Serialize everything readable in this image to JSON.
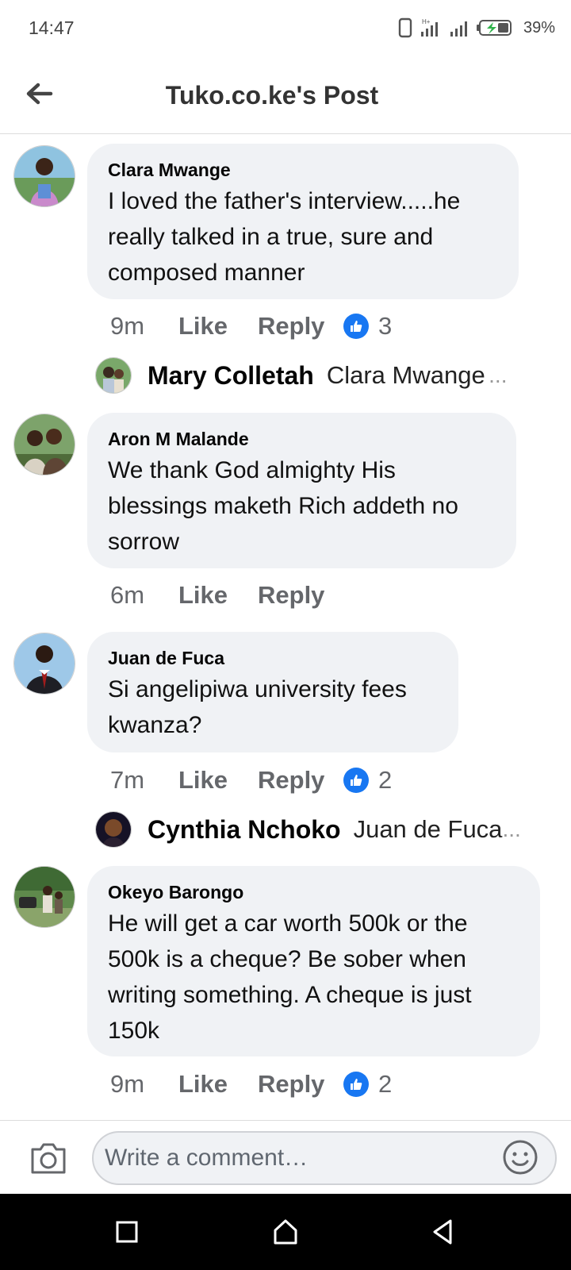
{
  "status_bar": {
    "time": "14:47",
    "battery_percent": "39%"
  },
  "header": {
    "title": "Tuko.co.ke's Post",
    "back_icon": "arrow-left-icon"
  },
  "comments": [
    {
      "author": "Clara Mwange",
      "text": "I loved the father's interview.....he really talked in a true, sure and composed manner",
      "time": "9m",
      "like_label": "Like",
      "reply_label": "Reply",
      "reaction_count": "3",
      "reply": {
        "name": "Mary Colletah",
        "snippet": "Clara Mwange",
        "ellipsis": "..."
      }
    },
    {
      "author": "Aron M Malande",
      "text": "We thank God almighty His blessings maketh Rich addeth no sorrow",
      "time": "6m",
      "like_label": "Like",
      "reply_label": "Reply"
    },
    {
      "author": "Juan de Fuca",
      "text": "Si angelipiwa university fees kwanza?",
      "time": "7m",
      "like_label": "Like",
      "reply_label": "Reply",
      "reaction_count": "2",
      "reply": {
        "name": "Cynthia Nchoko",
        "snippet": "Juan de Fuca",
        "ellipsis": "..."
      }
    },
    {
      "author": "Okeyo Barongo",
      "text": "He will get a car worth 500k or the 500k is a cheque?  Be sober when writing something. A cheque is just 150k",
      "time": "9m",
      "like_label": "Like",
      "reply_label": "Reply",
      "reaction_count": "2"
    }
  ],
  "composer": {
    "placeholder": "Write a comment…",
    "camera_icon": "camera-icon",
    "emoji_icon": "smiley-icon"
  },
  "colors": {
    "accent": "#1877f2",
    "bubble": "#f0f2f5",
    "muted_text": "#65676b"
  }
}
